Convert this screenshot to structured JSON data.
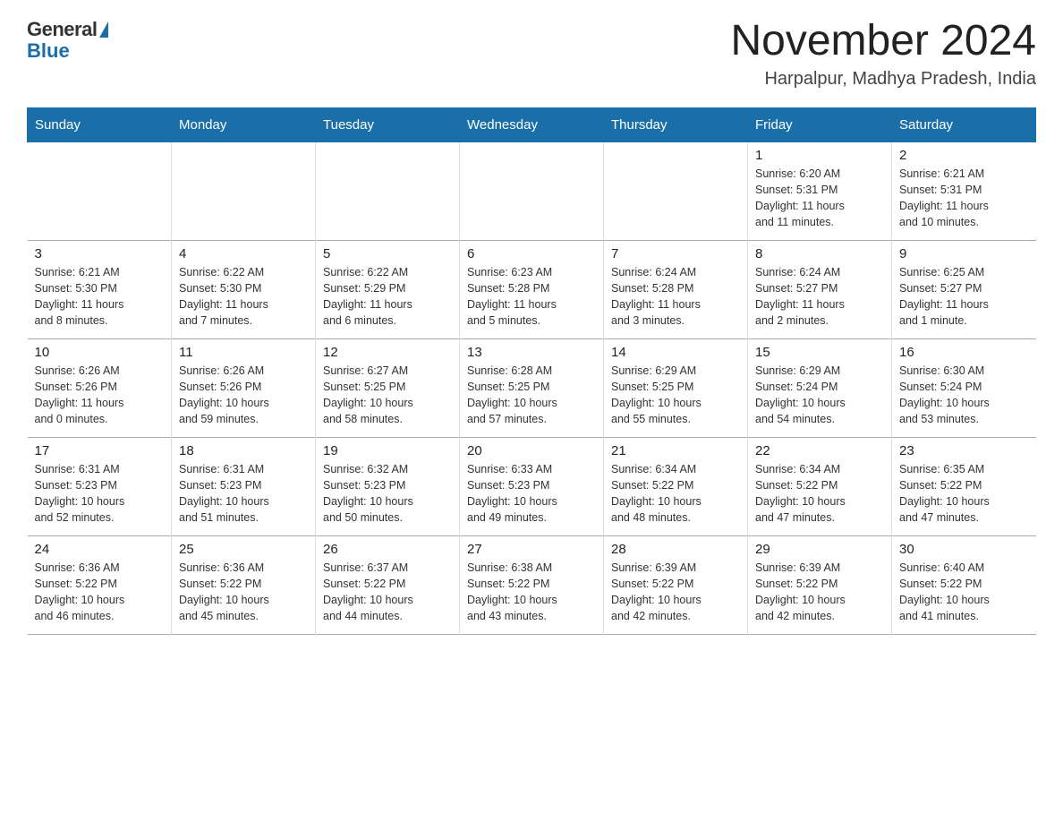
{
  "header": {
    "logo_general": "General",
    "logo_blue": "Blue",
    "title": "November 2024",
    "subtitle": "Harpalpur, Madhya Pradesh, India"
  },
  "weekdays": [
    "Sunday",
    "Monday",
    "Tuesday",
    "Wednesday",
    "Thursday",
    "Friday",
    "Saturday"
  ],
  "weeks": [
    [
      {
        "day": "",
        "info": ""
      },
      {
        "day": "",
        "info": ""
      },
      {
        "day": "",
        "info": ""
      },
      {
        "day": "",
        "info": ""
      },
      {
        "day": "",
        "info": ""
      },
      {
        "day": "1",
        "info": "Sunrise: 6:20 AM\nSunset: 5:31 PM\nDaylight: 11 hours\nand 11 minutes."
      },
      {
        "day": "2",
        "info": "Sunrise: 6:21 AM\nSunset: 5:31 PM\nDaylight: 11 hours\nand 10 minutes."
      }
    ],
    [
      {
        "day": "3",
        "info": "Sunrise: 6:21 AM\nSunset: 5:30 PM\nDaylight: 11 hours\nand 8 minutes."
      },
      {
        "day": "4",
        "info": "Sunrise: 6:22 AM\nSunset: 5:30 PM\nDaylight: 11 hours\nand 7 minutes."
      },
      {
        "day": "5",
        "info": "Sunrise: 6:22 AM\nSunset: 5:29 PM\nDaylight: 11 hours\nand 6 minutes."
      },
      {
        "day": "6",
        "info": "Sunrise: 6:23 AM\nSunset: 5:28 PM\nDaylight: 11 hours\nand 5 minutes."
      },
      {
        "day": "7",
        "info": "Sunrise: 6:24 AM\nSunset: 5:28 PM\nDaylight: 11 hours\nand 3 minutes."
      },
      {
        "day": "8",
        "info": "Sunrise: 6:24 AM\nSunset: 5:27 PM\nDaylight: 11 hours\nand 2 minutes."
      },
      {
        "day": "9",
        "info": "Sunrise: 6:25 AM\nSunset: 5:27 PM\nDaylight: 11 hours\nand 1 minute."
      }
    ],
    [
      {
        "day": "10",
        "info": "Sunrise: 6:26 AM\nSunset: 5:26 PM\nDaylight: 11 hours\nand 0 minutes."
      },
      {
        "day": "11",
        "info": "Sunrise: 6:26 AM\nSunset: 5:26 PM\nDaylight: 10 hours\nand 59 minutes."
      },
      {
        "day": "12",
        "info": "Sunrise: 6:27 AM\nSunset: 5:25 PM\nDaylight: 10 hours\nand 58 minutes."
      },
      {
        "day": "13",
        "info": "Sunrise: 6:28 AM\nSunset: 5:25 PM\nDaylight: 10 hours\nand 57 minutes."
      },
      {
        "day": "14",
        "info": "Sunrise: 6:29 AM\nSunset: 5:25 PM\nDaylight: 10 hours\nand 55 minutes."
      },
      {
        "day": "15",
        "info": "Sunrise: 6:29 AM\nSunset: 5:24 PM\nDaylight: 10 hours\nand 54 minutes."
      },
      {
        "day": "16",
        "info": "Sunrise: 6:30 AM\nSunset: 5:24 PM\nDaylight: 10 hours\nand 53 minutes."
      }
    ],
    [
      {
        "day": "17",
        "info": "Sunrise: 6:31 AM\nSunset: 5:23 PM\nDaylight: 10 hours\nand 52 minutes."
      },
      {
        "day": "18",
        "info": "Sunrise: 6:31 AM\nSunset: 5:23 PM\nDaylight: 10 hours\nand 51 minutes."
      },
      {
        "day": "19",
        "info": "Sunrise: 6:32 AM\nSunset: 5:23 PM\nDaylight: 10 hours\nand 50 minutes."
      },
      {
        "day": "20",
        "info": "Sunrise: 6:33 AM\nSunset: 5:23 PM\nDaylight: 10 hours\nand 49 minutes."
      },
      {
        "day": "21",
        "info": "Sunrise: 6:34 AM\nSunset: 5:22 PM\nDaylight: 10 hours\nand 48 minutes."
      },
      {
        "day": "22",
        "info": "Sunrise: 6:34 AM\nSunset: 5:22 PM\nDaylight: 10 hours\nand 47 minutes."
      },
      {
        "day": "23",
        "info": "Sunrise: 6:35 AM\nSunset: 5:22 PM\nDaylight: 10 hours\nand 47 minutes."
      }
    ],
    [
      {
        "day": "24",
        "info": "Sunrise: 6:36 AM\nSunset: 5:22 PM\nDaylight: 10 hours\nand 46 minutes."
      },
      {
        "day": "25",
        "info": "Sunrise: 6:36 AM\nSunset: 5:22 PM\nDaylight: 10 hours\nand 45 minutes."
      },
      {
        "day": "26",
        "info": "Sunrise: 6:37 AM\nSunset: 5:22 PM\nDaylight: 10 hours\nand 44 minutes."
      },
      {
        "day": "27",
        "info": "Sunrise: 6:38 AM\nSunset: 5:22 PM\nDaylight: 10 hours\nand 43 minutes."
      },
      {
        "day": "28",
        "info": "Sunrise: 6:39 AM\nSunset: 5:22 PM\nDaylight: 10 hours\nand 42 minutes."
      },
      {
        "day": "29",
        "info": "Sunrise: 6:39 AM\nSunset: 5:22 PM\nDaylight: 10 hours\nand 42 minutes."
      },
      {
        "day": "30",
        "info": "Sunrise: 6:40 AM\nSunset: 5:22 PM\nDaylight: 10 hours\nand 41 minutes."
      }
    ]
  ]
}
